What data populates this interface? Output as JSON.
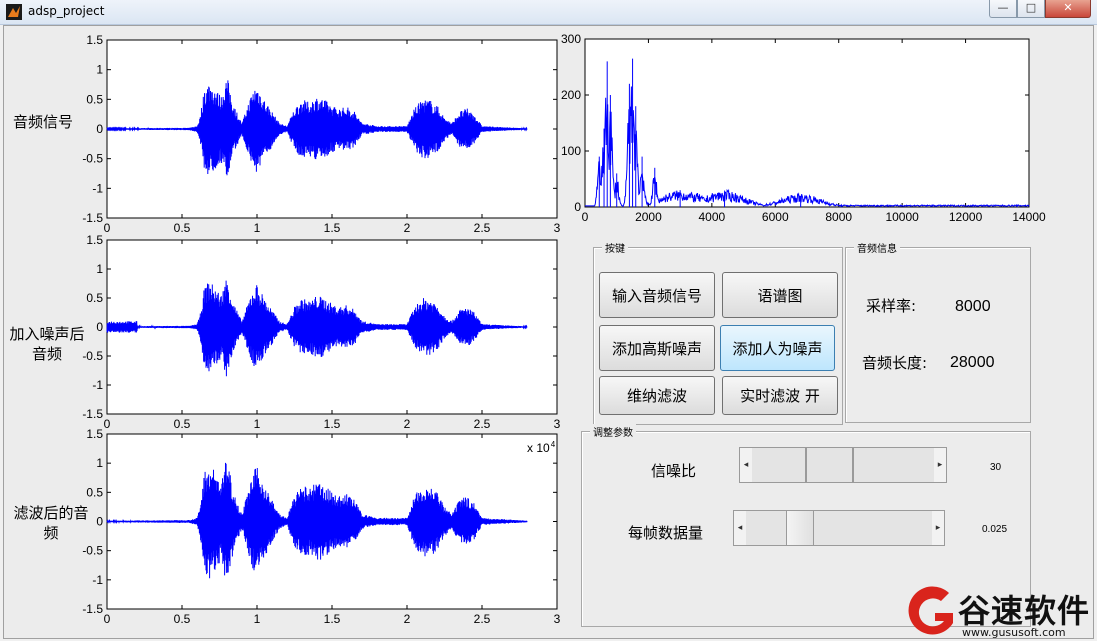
{
  "window": {
    "title": "adsp_project",
    "buttons": [
      "—",
      "□",
      "✕"
    ],
    "icon": "matlab-icon"
  },
  "axes_labels": {
    "signal": "音频信号",
    "noisy_line1": "加入噪声后",
    "noisy_line2": "音频",
    "filtered_line1": "滤波后的音",
    "filtered_line2": "频",
    "exponent_label": "x 10",
    "exponent_power": "4"
  },
  "buttons_panel": {
    "title": "按键",
    "input_audio": "输入音频信号",
    "spectrogram": "语谱图",
    "add_gaussian": "添加高斯噪声",
    "add_artificial": "添加人为噪声",
    "wiener": "维纳滤波",
    "realtime": "实时滤波 开"
  },
  "info_panel": {
    "title": "音频信息",
    "sample_rate_label": "采样率:",
    "sample_rate_value": "8000",
    "length_label": "音频长度:",
    "length_value": "28000"
  },
  "params_panel": {
    "title": "调整参数",
    "snr_label": "信噪比",
    "snr_value": "30",
    "frame_label": "每帧数据量",
    "frame_value": "0.025",
    "snr_level": 0.3,
    "frame_level": 0.025
  },
  "watermark": {
    "brand": "谷速软件",
    "url": "www.gususoft.com"
  },
  "chart_data": [
    {
      "type": "line",
      "name_key": "waveform-original",
      "xlim": [
        0,
        3
      ],
      "ylim": [
        -1.5,
        1.5
      ],
      "xticks": [
        "0",
        "0.5",
        "1",
        "1.5",
        "2",
        "2.5",
        "3"
      ],
      "yticks": [
        "1.5",
        "1",
        "0.5",
        "0",
        "-0.5",
        "-1",
        "-1.5"
      ],
      "envelope_x": [
        0,
        0.55,
        0.6,
        0.62,
        0.65,
        0.68,
        0.72,
        0.76,
        0.8,
        0.84,
        0.88,
        0.9,
        0.95,
        0.98,
        1.0,
        1.05,
        1.1,
        1.15,
        1.2,
        1.25,
        1.3,
        1.35,
        1.4,
        1.45,
        1.5,
        1.55,
        1.6,
        1.65,
        1.7,
        1.75,
        1.8,
        1.85,
        1.9,
        1.95,
        2.0,
        2.05,
        2.1,
        2.15,
        2.2,
        2.25,
        2.3,
        2.35,
        2.4,
        2.45,
        2.5,
        2.8
      ],
      "envelope_y": [
        0.01,
        0.02,
        0.05,
        0.2,
        0.7,
        0.8,
        0.7,
        0.55,
        0.9,
        0.45,
        0.2,
        0.1,
        0.5,
        0.7,
        0.75,
        0.5,
        0.3,
        0.1,
        0.05,
        0.35,
        0.5,
        0.45,
        0.55,
        0.5,
        0.4,
        0.35,
        0.38,
        0.3,
        0.1,
        0.08,
        0.05,
        0.05,
        0.05,
        0.05,
        0.05,
        0.35,
        0.5,
        0.5,
        0.4,
        0.2,
        0.1,
        0.3,
        0.35,
        0.25,
        0.05,
        0.01
      ],
      "noise_floor": 0.01,
      "noise_start": 0
    },
    {
      "type": "line",
      "name_key": "waveform-noisy",
      "xlim": [
        0,
        3
      ],
      "ylim": [
        -1.5,
        1.5
      ],
      "xticks": [
        "0",
        "0.5",
        "1",
        "1.5",
        "2",
        "2.5",
        "3"
      ],
      "yticks": [
        "1.5",
        "1",
        "0.5",
        "0",
        "-0.5",
        "-1",
        "-1.5"
      ],
      "noise_floor": 0.1,
      "noise_start": 0,
      "noise_end": 0.2
    },
    {
      "type": "line",
      "name_key": "waveform-filtered",
      "xlim": [
        0,
        3
      ],
      "ylim": [
        -1.5,
        1.5
      ],
      "xticks": [
        "0",
        "0.5",
        "1",
        "1.5",
        "2",
        "2.5",
        "3"
      ],
      "yticks": [
        "1.5",
        "1",
        "0.5",
        "0",
        "-0.5",
        "-1",
        "-1.5"
      ],
      "noise_floor": 0.02,
      "gain": 1.25
    },
    {
      "type": "line",
      "name_key": "spectrum",
      "xlim": [
        0,
        14000
      ],
      "ylim": [
        0,
        300
      ],
      "xticks": [
        "0",
        "2000",
        "4000",
        "6000",
        "8000",
        "10000",
        "12000",
        "14000"
      ],
      "yticks": [
        "300",
        "200",
        "100",
        "0"
      ],
      "peaks": [
        {
          "x": 450,
          "y": 90
        },
        {
          "x": 600,
          "y": 140
        },
        {
          "x": 700,
          "y": 260
        },
        {
          "x": 800,
          "y": 200
        },
        {
          "x": 1000,
          "y": 60
        },
        {
          "x": 1400,
          "y": 220
        },
        {
          "x": 1500,
          "y": 265
        },
        {
          "x": 1600,
          "y": 180
        },
        {
          "x": 1800,
          "y": 90
        },
        {
          "x": 2200,
          "y": 70
        },
        {
          "x": 3000,
          "y": 30
        },
        {
          "x": 4400,
          "y": 25
        },
        {
          "x": 6800,
          "y": 20
        }
      ]
    }
  ]
}
